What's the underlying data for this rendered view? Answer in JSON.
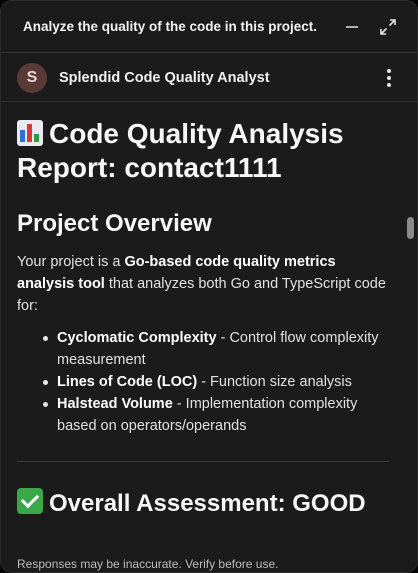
{
  "window": {
    "title": "Analyze the quality of the code in this project."
  },
  "agent": {
    "avatar_letter": "S",
    "name": "Splendid Code Quality Analyst"
  },
  "report": {
    "title": "Code Quality Analysis Report: contact1111",
    "title_icon": "bar-chart-icon",
    "overview": {
      "heading": "Project Overview",
      "intro_prefix": "Your project is a ",
      "intro_bold": "Go-based code quality metrics analysis tool",
      "intro_suffix": " that analyzes both Go and TypeScript code for:",
      "metrics": [
        {
          "name": "Cyclomatic Complexity",
          "desc": " - Control flow complexity measurement"
        },
        {
          "name": "Lines of Code (LOC)",
          "desc": " - Function size analysis"
        },
        {
          "name": "Halstead Volume",
          "desc": " - Implementation complexity based on operators/operands"
        }
      ]
    },
    "assessment": {
      "heading": "Overall Assessment: GOOD",
      "icon": "check-mark-icon"
    }
  },
  "footer": {
    "disclaimer": "Responses may be inaccurate. Verify before use."
  },
  "colors": {
    "panel_bg": "#1b1b1b",
    "avatar_bg": "#5a3a36",
    "check_green": "#3aa74a"
  }
}
